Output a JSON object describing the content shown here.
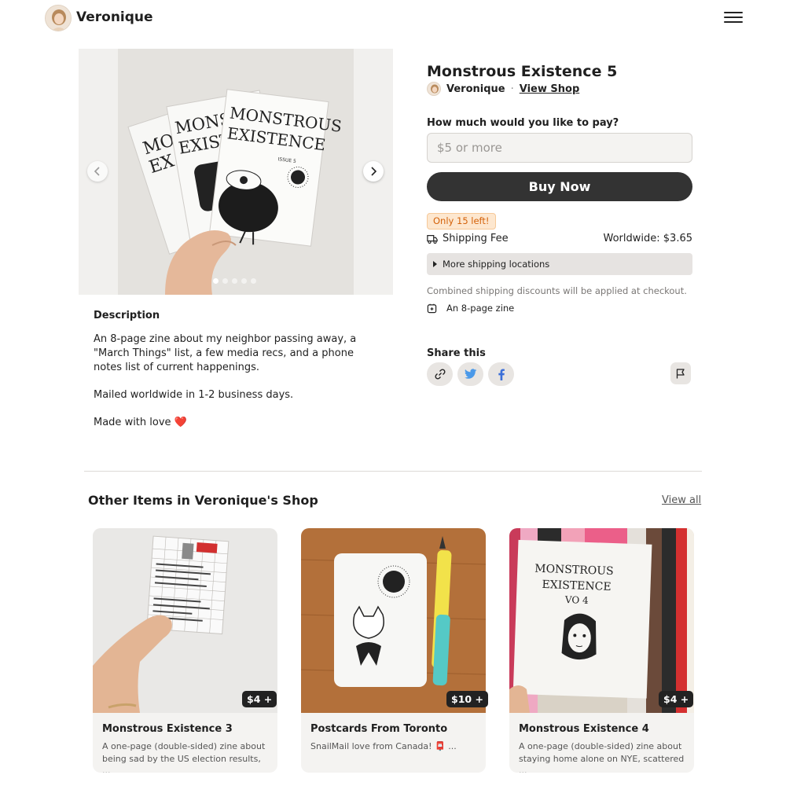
{
  "header": {
    "brand": "Veronique",
    "menu_icon": "hamburger-menu-icon"
  },
  "product": {
    "title": "Monstrous Existence 5",
    "seller": "Veronique",
    "separator": "·",
    "view_shop": "View Shop",
    "pay_label": "How much would you like to pay?",
    "pay_placeholder": "$5 or more",
    "buy_label": "Buy Now",
    "stock_badge": "Only 15 left!",
    "shipping_label": "Shipping Fee",
    "shipping_value": "Worldwide: $3.65",
    "more_shipping": "More shipping locations",
    "combined_note": "Combined shipping discounts will be applied at checkout.",
    "product_type": "An 8-page zine",
    "gallery": {
      "image_count": 5,
      "active_index": 0
    }
  },
  "description": {
    "title": "Description",
    "paragraph_1": "An 8-page zine about my neighbor passing away, a \"March Things\" list, a few media recs, and a phone notes list of current happenings.",
    "paragraph_2": "Mailed worldwide in 1-2 business days.",
    "paragraph_3": "Made with love",
    "heart": "❤️"
  },
  "share": {
    "label": "Share this",
    "icons": [
      "link-icon",
      "twitter-icon",
      "facebook-icon"
    ],
    "report_icon": "flag-icon"
  },
  "other_items": {
    "title": "Other Items in Veronique's Shop",
    "view_all": "View all",
    "items": [
      {
        "title": "Monstrous Existence 3",
        "price": "$4 +",
        "description": "A one-page (double-sided) zine about being sad by the US election results, ..."
      },
      {
        "title": "Postcards From Toronto",
        "price": "$10 +",
        "description": "SnailMail love from Canada! 📮 ..."
      },
      {
        "title": "Monstrous Existence 4",
        "price": "$4 +",
        "description": "A one-page (double-sided) zine about staying home alone on NYE, scattered ..."
      }
    ]
  },
  "colors": {
    "buy_button": "#333333",
    "stock_text": "#d4620a",
    "stock_bg": "#fde7cf",
    "twitter": "#4a99e9",
    "facebook": "#3b6fd8",
    "heart": "#e53935"
  }
}
